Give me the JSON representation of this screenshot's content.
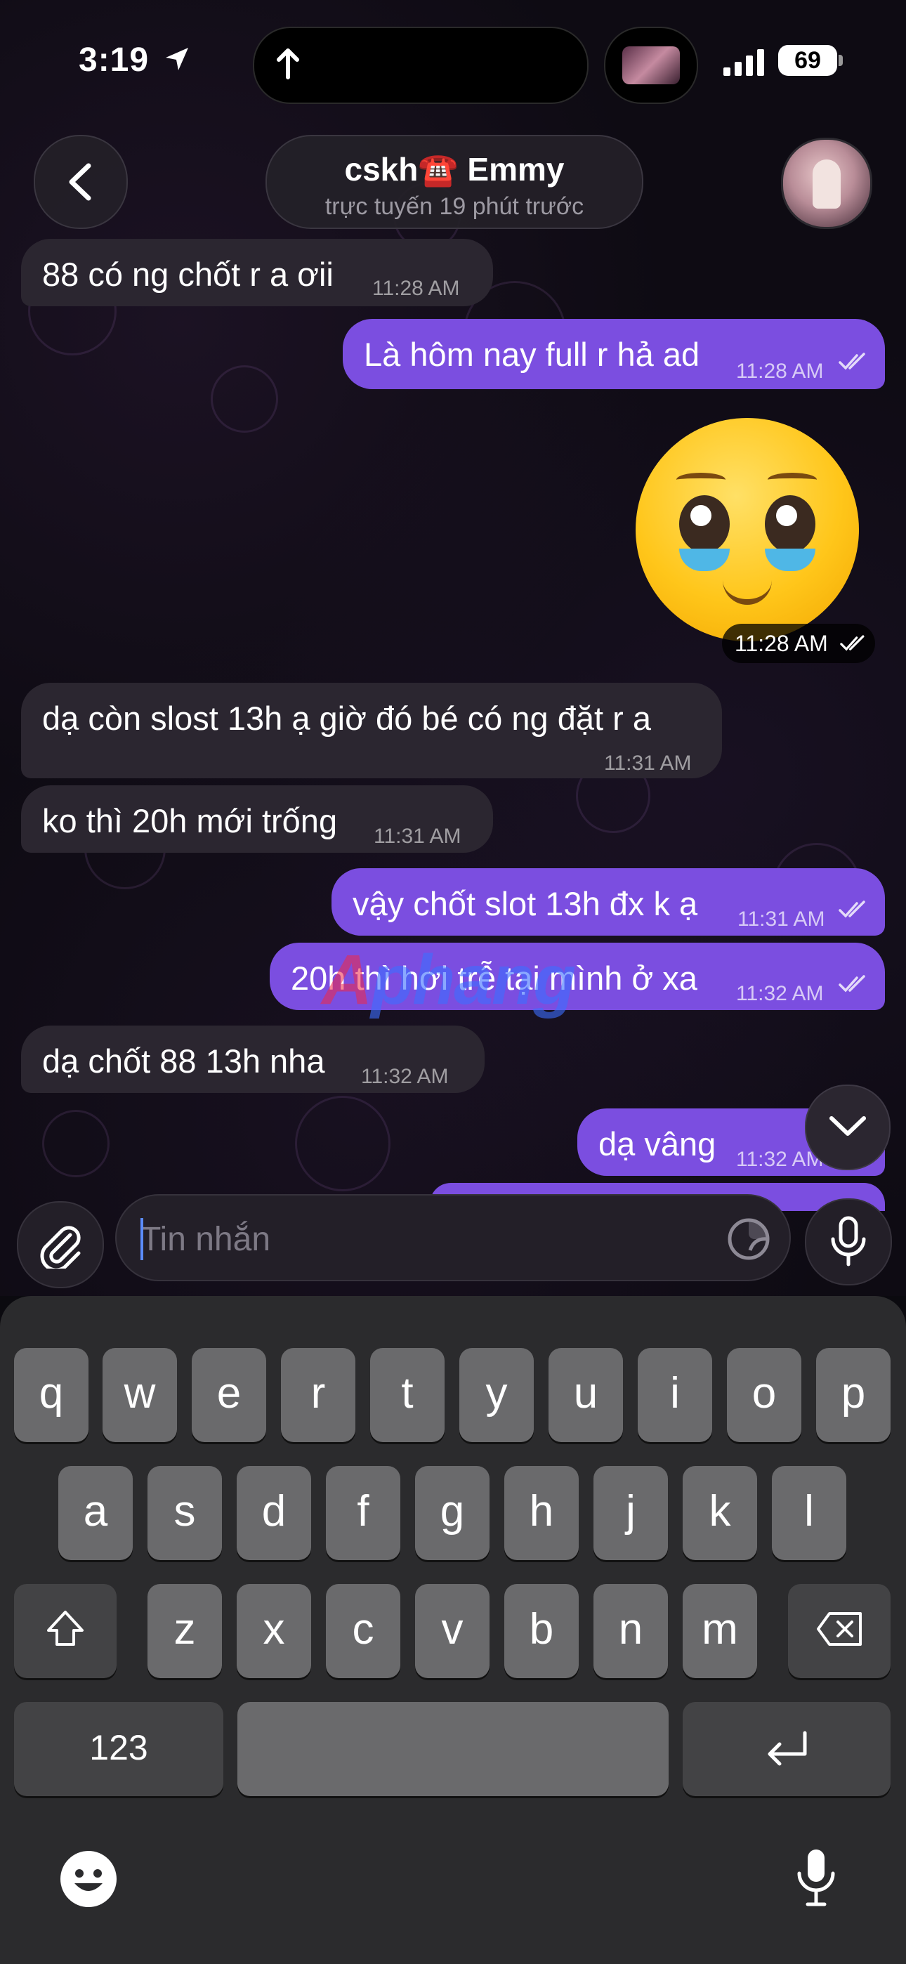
{
  "status_bar": {
    "time": "3:19",
    "battery": "69"
  },
  "header": {
    "contact_name": "cskh☎️ Emmy",
    "presence": "trực tuyến 19 phút trước"
  },
  "messages": [
    {
      "direction": "in",
      "text": "88 có ng chốt r a ơii",
      "time": "11:28 AM"
    },
    {
      "direction": "out",
      "text": "Là hôm nay full r hả ad",
      "time": "11:28 AM",
      "read": true
    },
    {
      "direction": "out",
      "type": "sticker",
      "emoji": "pleading-face",
      "time": "11:28 AM",
      "read": true
    },
    {
      "direction": "in",
      "text": "dạ còn slost 13h ạ giờ đó bé có ng đặt r a",
      "time": "11:31 AM"
    },
    {
      "direction": "in",
      "text": "ko thì 20h mới trống",
      "time": "11:31 AM"
    },
    {
      "direction": "out",
      "text": "vậy chốt slot 13h đx k ạ",
      "time": "11:31 AM",
      "read": true
    },
    {
      "direction": "out",
      "text": "20h thì hơi trễ tại mình ở xa",
      "time": "11:32 AM",
      "read": true
    },
    {
      "direction": "in",
      "text": "dạ chốt 88 13h nha",
      "time": "11:32 AM"
    },
    {
      "direction": "out",
      "text": "dạ vâng",
      "time": "11:32 AM",
      "read": true
    }
  ],
  "watermark": {
    "part1": "A",
    "part2": "phang"
  },
  "composer": {
    "placeholder": "Tin nhắn",
    "value": ""
  },
  "keyboard": {
    "row1": [
      "q",
      "w",
      "e",
      "r",
      "t",
      "y",
      "u",
      "i",
      "o",
      "p"
    ],
    "row2": [
      "a",
      "s",
      "d",
      "f",
      "g",
      "h",
      "j",
      "k",
      "l"
    ],
    "row3": [
      "z",
      "x",
      "c",
      "v",
      "b",
      "n",
      "m"
    ],
    "numbers_key": "123"
  },
  "colors": {
    "outgoing": "#7b4ee0",
    "incoming": "#2b2630",
    "accent": "#5b8cff"
  },
  "icons": [
    "location-arrow-icon",
    "upload-arrow-icon",
    "signal-icon",
    "back-chevron-icon",
    "double-check-icon",
    "chevron-down-icon",
    "paperclip-icon",
    "sticker-icon",
    "microphone-icon",
    "shift-icon",
    "delete-icon",
    "return-icon",
    "emoji-icon",
    "dictation-icon"
  ]
}
